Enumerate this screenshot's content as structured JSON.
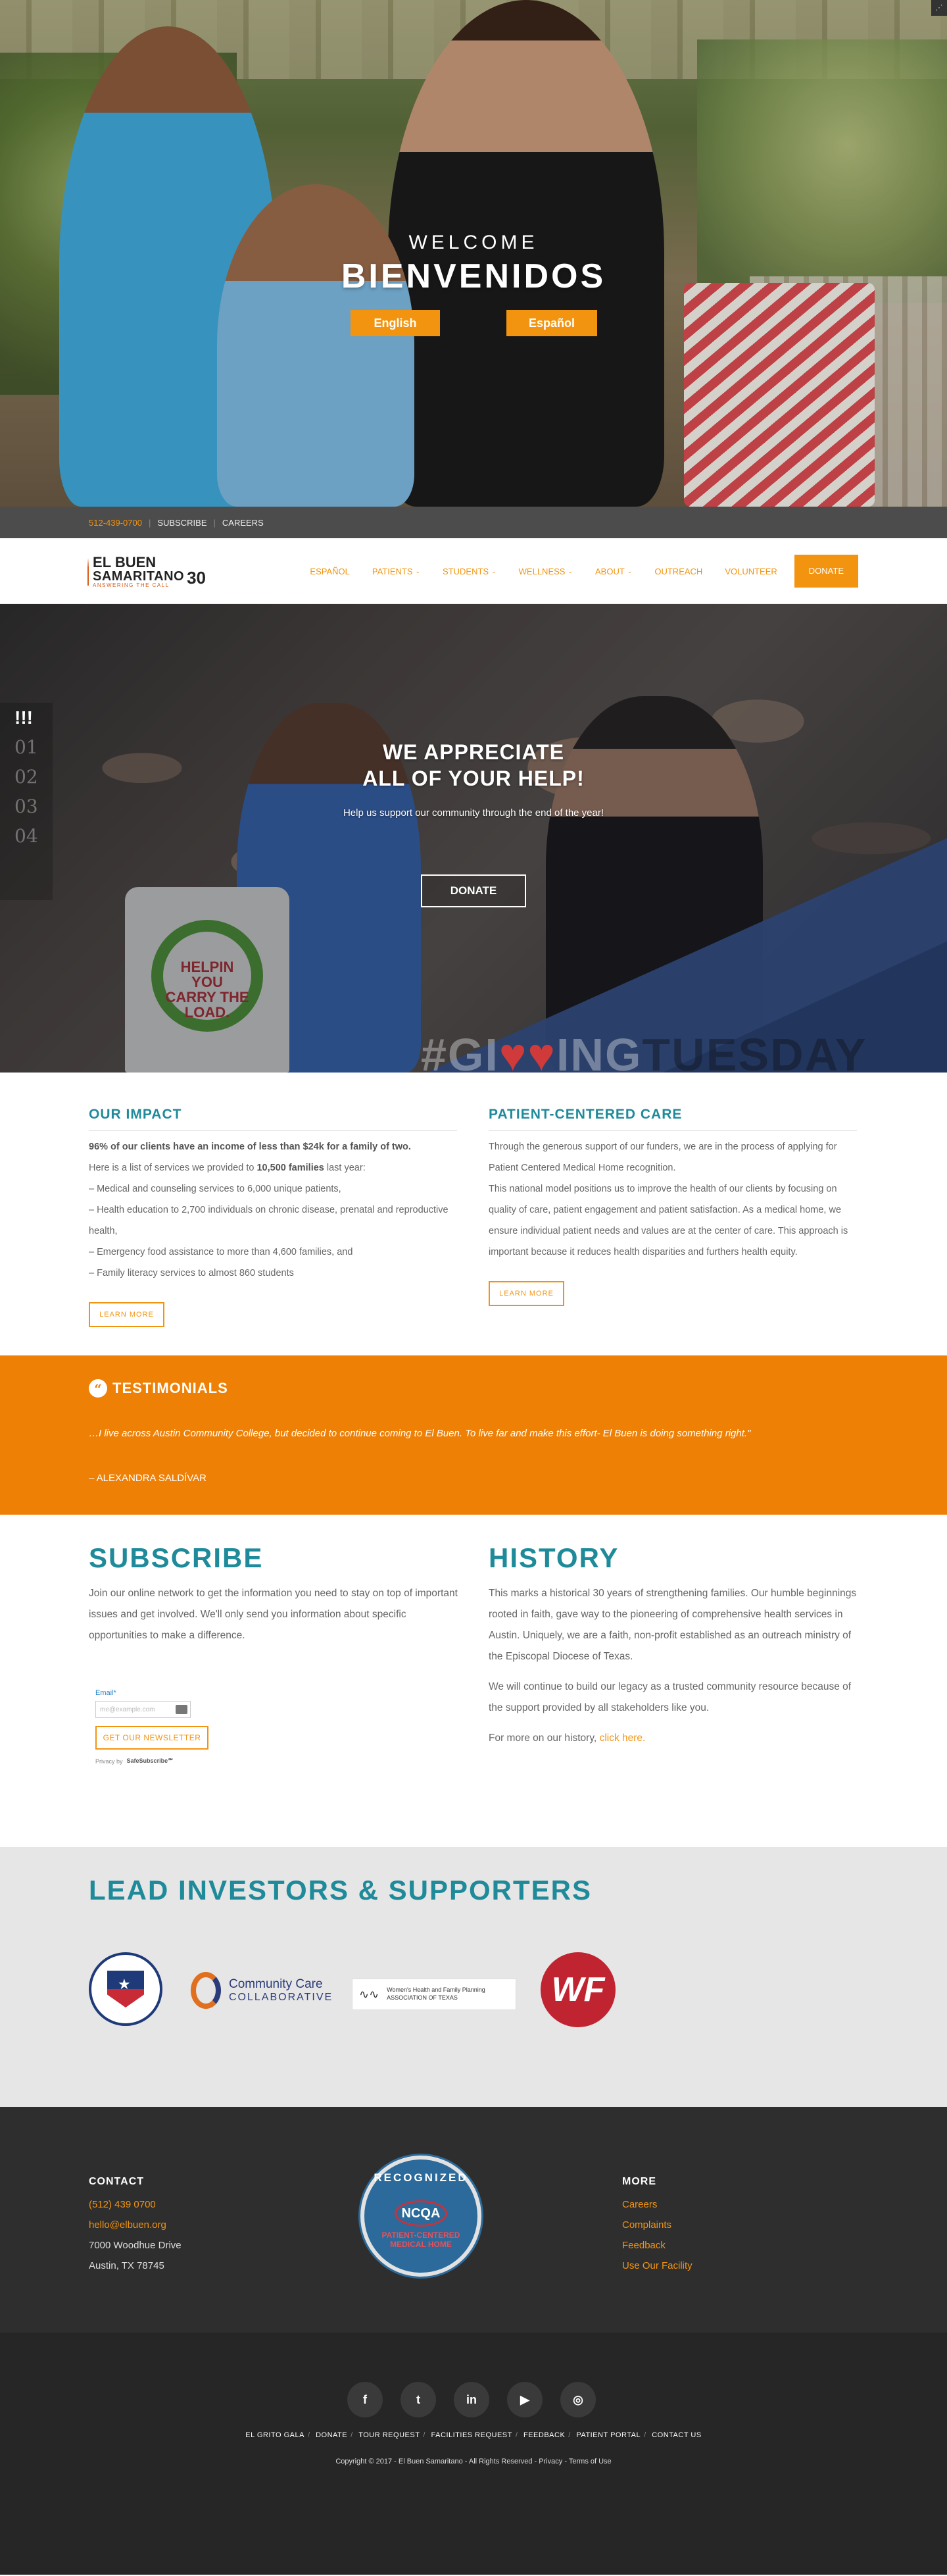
{
  "hero": {
    "welcome": "WELCOME",
    "title": "BIENVENIDOS",
    "btn_english": "English",
    "btn_espanol": "Español"
  },
  "topbar": {
    "phone": "512-439-0700",
    "subscribe": "SUBSCRIBE",
    "careers": "CAREERS"
  },
  "logo": {
    "line1": "EL BUEN",
    "line2": "SAMARITANO",
    "tagline": "ANSWERING THE CALL",
    "anniversary": "30"
  },
  "nav": {
    "items": [
      {
        "label": "ESPAÑOL",
        "dropdown": false
      },
      {
        "label": "PATIENTS",
        "dropdown": true
      },
      {
        "label": "STUDENTS",
        "dropdown": true
      },
      {
        "label": "WELLNESS",
        "dropdown": true
      },
      {
        "label": "ABOUT",
        "dropdown": true
      },
      {
        "label": "OUTREACH",
        "dropdown": false
      },
      {
        "label": "VOLUNTEER",
        "dropdown": false
      }
    ],
    "donate": "DONATE"
  },
  "slider": {
    "title_line1": "WE APPRECIATE",
    "title_line2": "ALL OF YOUR HELP!",
    "subtitle": "Help us support our community  through the end of the year!",
    "button": "DONATE",
    "numbers": [
      "!!!",
      "01",
      "02",
      "03",
      "04"
    ],
    "bag_text": "HELPIN YOU CARRY THE LOAD.",
    "overlay_gi": "#GI",
    "overlay_heart": "♥♥",
    "overlay_ing": "ING",
    "overlay_tuesday": "TUESDAY"
  },
  "impact": {
    "heading": "OUR IMPACT",
    "lead": "96% of our clients have an income of less than $24k for a family of two.",
    "intro_pre": "Here is a list of services we provided to ",
    "intro_bold": "10,500 families",
    "intro_post": " last year:",
    "items": [
      "– Medical and counseling services to 6,000 unique patients,",
      "– Health education to 2,700 individuals on chronic disease, prenatal and reproductive health,",
      "– Emergency food assistance to more than 4,600 families, and",
      "– Family literacy services to almost 860 students"
    ],
    "button": "LEARN MORE"
  },
  "care": {
    "heading": "PATIENT-CENTERED CARE",
    "p1": "Through the generous support of our funders, we are in the process of applying for Patient Centered Medical Home recognition.",
    "p2": "This national model positions us to improve the health of our clients by focusing on quality of care, patient engagement and patient satisfaction. As a medical home, we ensure individual patient needs and values are at the center of care. This approach is important because it reduces health disparities and furthers health equity.",
    "button": "LEARN MORE"
  },
  "testimonials": {
    "heading": "TESTIMONIALS",
    "quote": "…I live across Austin Community College, but decided to continue coming to El Buen. To live far and make this effort- El Buen is doing something right.\"",
    "author": "– ALEXANDRA SALDÍVAR"
  },
  "subscribe": {
    "heading": "SUBSCRIBE",
    "text": "Join our online network to get the information you need to stay on top of important issues and get involved. We'll only send you information about specific opportunities to make a difference.",
    "email_label": "Email*",
    "email_placeholder": "me@example.com",
    "button": "GET OUR NEWSLETTER",
    "privacy": "Privacy",
    "by": "by",
    "safe": "SafeSubscribe℠"
  },
  "history": {
    "heading": "HISTORY",
    "p1": "This marks a historical 30 years of strengthening families. Our humble beginnings rooted in faith, gave way to the pioneering of comprehensive health services in Austin. Uniquely, we are a faith, non-profit established as an outreach ministry of the Episcopal Diocese of Texas.",
    "p2": "We will continue to build our legacy as a trusted community resource because of the support provided by all stakeholders like you.",
    "p3_pre": "For more on our history, ",
    "p3_link": "click here."
  },
  "investors": {
    "heading": "LEAD INVESTORS & SUPPORTERS",
    "ccc_line1": "Community Care",
    "ccc_line2": "COLLABORATIVE",
    "whfp_line1": "Women's Health and Family Planning",
    "whfp_line2": "ASSOCIATION OF TEXAS",
    "wf_text": "WF"
  },
  "footer": {
    "contact_heading": "CONTACT",
    "phone": "(512) 439 0700",
    "email": "hello@elbuen.org",
    "address1": "7000 Woodhue Drive",
    "address2": "Austin, TX 78745",
    "more_heading": "MORE",
    "more_links": [
      "Careers",
      "Complaints",
      "Feedback",
      "Use Our Facility"
    ],
    "badge_top": "RECOGNIZED",
    "badge_mid": "NCQA",
    "badge_bottom": "PATIENT-CENTERED MEDICAL HOME",
    "links": [
      "EL GRITO GALA",
      "DONATE",
      "TOUR REQUEST",
      "FACILITIES REQUEST",
      "FEEDBACK",
      "PATIENT PORTAL",
      "CONTACT US"
    ],
    "copyright": "Copyright © 2017 - El Buen Samaritano - All Rights Reserved - Privacy - Terms of Use"
  },
  "colors": {
    "accent": "#f39410",
    "teal": "#1f8a9a",
    "testimonial_bg": "#ee8006",
    "footer_bg": "#2e2e2e"
  }
}
